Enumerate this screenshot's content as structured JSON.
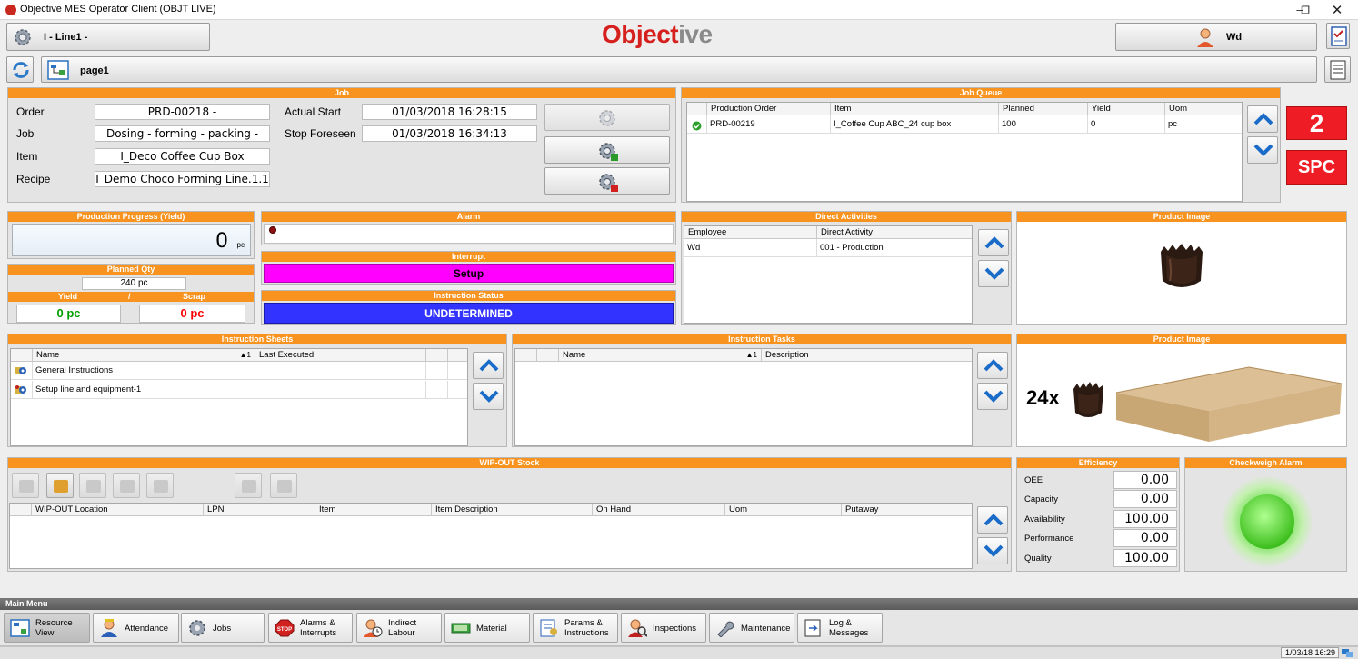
{
  "window": {
    "title": "Objective MES Operator Client (OBJT LIVE)"
  },
  "header": {
    "line_label": "I - Line1 -",
    "brand_prefix": "Object",
    "brand_suffix": "ive",
    "user_name": "Wd",
    "page_label": "page1"
  },
  "job": {
    "header": "Job",
    "order_label": "Order",
    "order_value": "PRD-00218 -",
    "job_label": "Job",
    "job_value": "Dosing - forming - packing -",
    "item_label": "Item",
    "item_value": "I_Deco Coffee Cup Box",
    "recipe_label": "Recipe",
    "recipe_value": "I_Demo Choco Forming Line.1.1",
    "actual_start_label": "Actual Start",
    "actual_start_value": "01/03/2018 16:28:15",
    "stop_foreseen_label": "Stop Foreseen",
    "stop_foreseen_value": "01/03/2018 16:34:13"
  },
  "job_queue": {
    "header": "Job Queue",
    "columns": [
      "Production Order",
      "Item",
      "Planned",
      "Yield",
      "Uom"
    ],
    "rows": [
      {
        "order": "PRD-00219",
        "item": "I_Coffee Cup ABC_24 cup box",
        "planned": "100",
        "yield": "0",
        "uom": "pc"
      }
    ],
    "counter": "2",
    "spc_label": "SPC"
  },
  "progress": {
    "header": "Production Progress (Yield)",
    "value": "0",
    "unit": "pc",
    "planned_header": "Planned Qty",
    "planned_value": "240 pc",
    "yield_label": "Yield",
    "separator": "/",
    "scrap_label": "Scrap",
    "yield_value": "0 pc",
    "scrap_value": "0 pc"
  },
  "alarm": {
    "header": "Alarm"
  },
  "interrupt": {
    "header": "Interrupt",
    "value": "Setup"
  },
  "instruction_status": {
    "header": "Instruction Status",
    "value": "UNDETERMINED"
  },
  "direct_activities": {
    "header": "Direct Activities",
    "columns": [
      "Employee",
      "Direct Activity"
    ],
    "rows": [
      {
        "employee": "Wd",
        "activity": "001 - Production"
      }
    ]
  },
  "product_image_1": {
    "header": "Product Image"
  },
  "product_image_2": {
    "header": "Product Image",
    "count_label": "24x"
  },
  "instruction_sheets": {
    "header": "Instruction Sheets",
    "columns": [
      "Name",
      "Last Executed"
    ],
    "sort_marker": "▲1",
    "rows": [
      {
        "name": "General Instructions"
      },
      {
        "name": "Setup line and equipment-1"
      }
    ]
  },
  "instruction_tasks": {
    "header": "Instruction Tasks",
    "columns": [
      "Name",
      "Description"
    ],
    "sort_marker": "▲1"
  },
  "wip": {
    "header": "WIP-OUT Stock",
    "columns": [
      "WIP-OUT Location",
      "LPN",
      "Item",
      "Item Description",
      "On Hand",
      "Uom",
      "Putaway"
    ]
  },
  "efficiency": {
    "header": "Efficiency",
    "rows": [
      {
        "label": "OEE",
        "value": "0.00"
      },
      {
        "label": "Capacity",
        "value": "0.00"
      },
      {
        "label": "Availability",
        "value": "100.00"
      },
      {
        "label": "Performance",
        "value": "0.00"
      },
      {
        "label": "Quality",
        "value": "100.00"
      }
    ]
  },
  "checkweigh": {
    "header": "Checkweigh Alarm"
  },
  "main_menu": {
    "label": "Main Menu",
    "items": [
      {
        "line1": "Resource",
        "line2": "View"
      },
      {
        "line1": "Attendance",
        "line2": ""
      },
      {
        "line1": "Jobs",
        "line2": ""
      },
      {
        "line1": "Alarms &",
        "line2": "Interrupts"
      },
      {
        "line1": "Indirect",
        "line2": "Labour"
      },
      {
        "line1": "Material",
        "line2": ""
      },
      {
        "line1": "Params &",
        "line2": "Instructions"
      },
      {
        "line1": "Inspections",
        "line2": ""
      },
      {
        "line1": "Maintenance",
        "line2": ""
      },
      {
        "line1": "Log &",
        "line2": "Messages"
      }
    ]
  },
  "status_bar": {
    "datetime": "1/03/18 16:29"
  },
  "colors": {
    "accent": "#f7931e",
    "interrupt": "#ff00ff",
    "status": "#3333ff",
    "spc": "#ee1c24",
    "yield": "#00a000",
    "scrap": "#ff0000"
  }
}
